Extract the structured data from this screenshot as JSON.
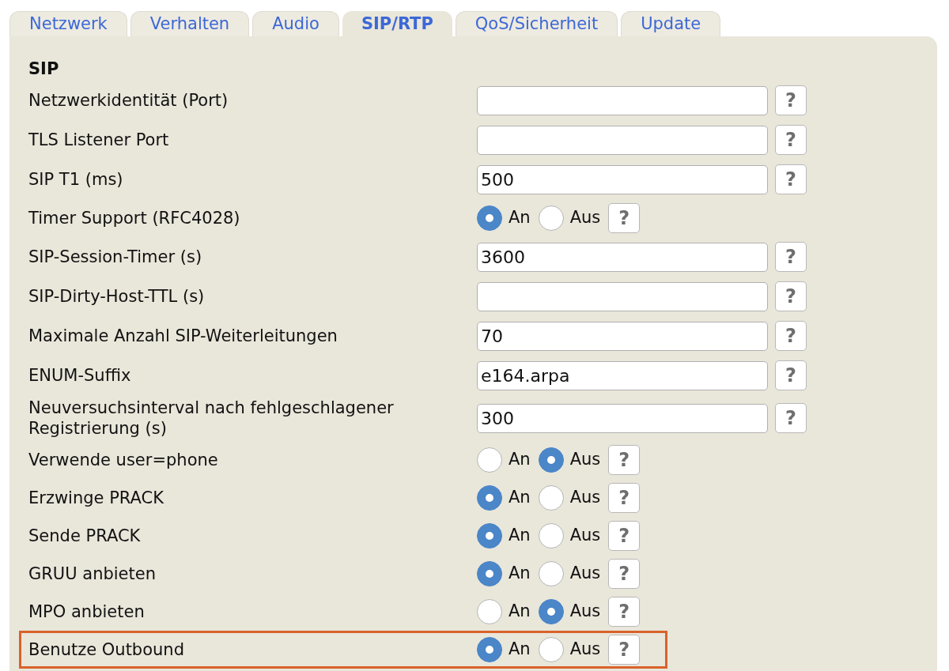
{
  "tabs": [
    {
      "label": "Netzwerk",
      "selected": false
    },
    {
      "label": "Verhalten",
      "selected": false
    },
    {
      "label": "Audio",
      "selected": false
    },
    {
      "label": "SIP/RTP",
      "selected": true
    },
    {
      "label": "QoS/Sicherheit",
      "selected": false
    },
    {
      "label": "Update",
      "selected": false
    }
  ],
  "section_title": "SIP",
  "rows": [
    {
      "kind": "text",
      "label": "Netzwerkidentität (Port)",
      "value": "",
      "help": "?",
      "highlighted": false
    },
    {
      "kind": "text",
      "label": "TLS Listener Port",
      "value": "",
      "help": "?",
      "highlighted": false
    },
    {
      "kind": "text",
      "label": "SIP T1 (ms)",
      "value": "500",
      "help": "?",
      "highlighted": false
    },
    {
      "kind": "radio",
      "label": "Timer Support (RFC4028)",
      "options": [
        {
          "label": "An",
          "selected": true
        },
        {
          "label": "Aus",
          "selected": false
        }
      ],
      "help": "?",
      "highlighted": false
    },
    {
      "kind": "text",
      "label": "SIP-Session-Timer (s)",
      "value": "3600",
      "help": "?",
      "highlighted": false
    },
    {
      "kind": "text",
      "label": "SIP-Dirty-Host-TTL (s)",
      "value": "",
      "help": "?",
      "highlighted": false
    },
    {
      "kind": "text",
      "label": "Maximale Anzahl SIP-Weiterleitungen",
      "value": "70",
      "help": "?",
      "highlighted": false
    },
    {
      "kind": "text",
      "label": "ENUM-Suffix",
      "value": "e164.arpa",
      "help": "?",
      "highlighted": false
    },
    {
      "kind": "text",
      "label": "Neuversuchsinterval nach fehlgeschlagener Registrierung (s)",
      "value": "300",
      "help": "?",
      "highlighted": false
    },
    {
      "kind": "radio",
      "label": "Verwende user=phone",
      "options": [
        {
          "label": "An",
          "selected": false
        },
        {
          "label": "Aus",
          "selected": true
        }
      ],
      "help": "?",
      "highlighted": false
    },
    {
      "kind": "radio",
      "label": "Erzwinge PRACK",
      "options": [
        {
          "label": "An",
          "selected": true
        },
        {
          "label": "Aus",
          "selected": false
        }
      ],
      "help": "?",
      "highlighted": false
    },
    {
      "kind": "radio",
      "label": "Sende PRACK",
      "options": [
        {
          "label": "An",
          "selected": true
        },
        {
          "label": "Aus",
          "selected": false
        }
      ],
      "help": "?",
      "highlighted": false
    },
    {
      "kind": "radio",
      "label": "GRUU anbieten",
      "options": [
        {
          "label": "An",
          "selected": true
        },
        {
          "label": "Aus",
          "selected": false
        }
      ],
      "help": "?",
      "highlighted": false
    },
    {
      "kind": "radio",
      "label": "MPO anbieten",
      "options": [
        {
          "label": "An",
          "selected": false
        },
        {
          "label": "Aus",
          "selected": true
        }
      ],
      "help": "?",
      "highlighted": false
    },
    {
      "kind": "radio",
      "label": "Benutze Outbound",
      "options": [
        {
          "label": "An",
          "selected": true
        },
        {
          "label": "Aus",
          "selected": false
        }
      ],
      "help": "?",
      "highlighted": true
    }
  ]
}
